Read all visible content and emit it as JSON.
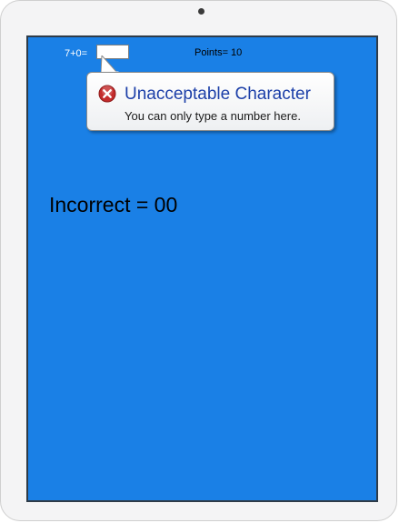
{
  "quiz": {
    "equation": "7+0=",
    "answer_value": "",
    "points_label": "Points= 10",
    "incorrect_label": "Incorrect = 00"
  },
  "tooltip": {
    "icon": "error-icon",
    "title": "Unacceptable Character",
    "message": "You can only type a number here."
  },
  "colors": {
    "screen_background": "#1a80e6",
    "tooltip_title": "#1c3fa8",
    "error_icon": "#c42b2b"
  }
}
